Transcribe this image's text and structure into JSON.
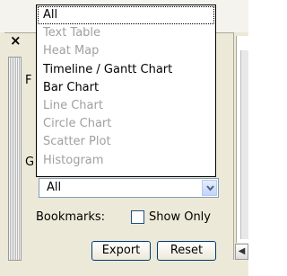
{
  "background": {
    "close_glyph": "×",
    "partial_label_1": "F",
    "partial_label_2": "G"
  },
  "dropdown": {
    "options": [
      {
        "label": "All",
        "enabled": true,
        "selected": true
      },
      {
        "label": "Text Table",
        "enabled": false
      },
      {
        "label": "Heat Map",
        "enabled": false
      },
      {
        "label": "Timeline / Gantt Chart",
        "enabled": true
      },
      {
        "label": "Bar Chart",
        "enabled": true
      },
      {
        "label": "Line Chart",
        "enabled": false
      },
      {
        "label": "Circle Chart",
        "enabled": false
      },
      {
        "label": "Scatter Plot",
        "enabled": false
      },
      {
        "label": "Histogram",
        "enabled": false
      }
    ]
  },
  "combo": {
    "value": "All"
  },
  "bookmarks": {
    "label": "Bookmarks:",
    "show_only_label": "Show Only",
    "show_only_checked": false
  },
  "buttons": {
    "export_label": "Export",
    "reset_label": "Reset"
  },
  "colors": {
    "window_bg": "#ece9d8",
    "disabled_text": "#a0a0a0",
    "button_border": "#003c74",
    "combo_border": "#7f9db9"
  },
  "icons": {
    "combo_arrow": "chevron-down-icon",
    "scroll_left": "scroll-left-icon"
  }
}
